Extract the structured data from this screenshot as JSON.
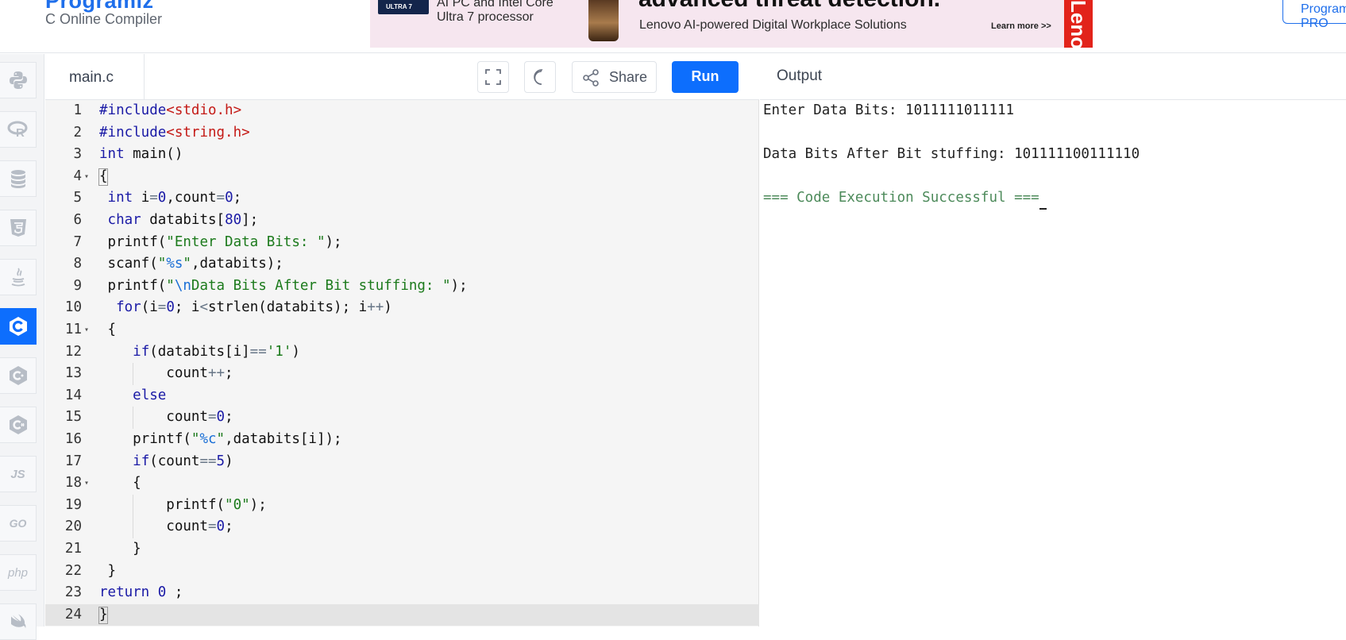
{
  "header": {
    "brand": "Programiz",
    "subtitle": "C Online Compiler",
    "right_button": "Programiz PRO"
  },
  "ad": {
    "badge": "ULTRA 7",
    "small_text_1": "AI PC and Intel Core",
    "small_text_2": "Ultra 7 processor",
    "headline": "advanced threat detection.",
    "line": "Lenovo AI-powered Digital Workplace Solutions",
    "learn_more": "Learn more >>",
    "logo": "Lenovo"
  },
  "sidebar": {
    "languages": [
      {
        "name": "python",
        "label": ""
      },
      {
        "name": "r",
        "label": "R"
      },
      {
        "name": "sql",
        "label": ""
      },
      {
        "name": "html",
        "label": "5"
      },
      {
        "name": "java",
        "label": ""
      },
      {
        "name": "c",
        "label": "C"
      },
      {
        "name": "cpp",
        "label": "C"
      },
      {
        "name": "csharp",
        "label": "C"
      },
      {
        "name": "js",
        "label": "JS"
      },
      {
        "name": "go",
        "label": "GO"
      },
      {
        "name": "php",
        "label": "php"
      },
      {
        "name": "swift",
        "label": ""
      }
    ],
    "active": "c"
  },
  "editor": {
    "file_tab": "main.c",
    "share_label": "Share",
    "run_label": "Run",
    "current_line": 24
  },
  "code_lines": [
    "#include<stdio.h>",
    "#include<string.h>",
    "int main()",
    "{",
    " int i=0,count=0;",
    " char databits[80];",
    " printf(\"Enter Data Bits: \");",
    " scanf(\"%s\",databits);",
    " printf(\"\\nData Bits After Bit stuffing: \");",
    "  for(i=0; i<strlen(databits); i++)",
    " {",
    "    if(databits[i]=='1')",
    "        count++;",
    "    else",
    "        count=0;",
    "    printf(\"%c\",databits[i]);",
    "    if(count==5)",
    "    {",
    "        printf(\"0\");",
    "        count=0;",
    "    }",
    " }",
    "return 0 ;",
    "}"
  ],
  "output": {
    "title": "Output",
    "lines": [
      "Enter Data Bits: 1011111011111",
      "",
      "Data Bits After Bit stuffing: 101111100111110",
      "",
      "=== Code Execution Successful ==="
    ]
  }
}
